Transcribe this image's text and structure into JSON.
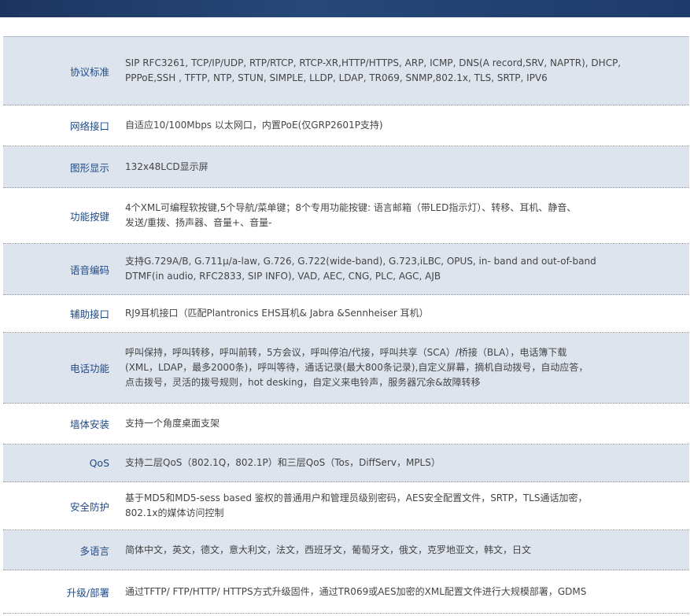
{
  "specs": [
    {
      "label": "协议标准",
      "value": "SIP RFC3261, TCP/IP/UDP, RTP/RTCP, RTCP-XR,HTTP/HTTPS, ARP, ICMP, DNS(A record,SRV, NAPTR), DHCP,\nPPPoE,SSH , TFTP, NTP, STUN, SIMPLE, LLDP, LDAP, TR069, SNMP,802.1x, TLS, SRTP, IPV6"
    },
    {
      "label": "网络接口",
      "value": "自适应10/100Mbps 以太网口，内置PoE(仅GRP2601P支持)"
    },
    {
      "label": "图形显示",
      "value": "132x48LCD显示屏"
    },
    {
      "label": "功能按键",
      "value": "4个XML可编程软按键,5个导航/菜单键；8个专用功能按键: 语言邮箱（带LED指示灯）、转移、耳机、静音、\n发送/重拨、扬声器、音量+、音量-"
    },
    {
      "label": "语音编码",
      "value": "支持G.729A/B, G.711µ/a-law, G.726, G.722(wide-band), G.723,iLBC, OPUS, in- band and out-of-band\nDTMF(in audio, RFC2833, SIP INFO), VAD, AEC, CNG, PLC, AGC, AJB"
    },
    {
      "label": "辅助接口",
      "value": "RJ9耳机接口（匹配Plantronics EHS耳机& Jabra &Sennheiser 耳机）"
    },
    {
      "label": "电话功能",
      "value": "呼叫保持，呼叫转移，呼叫前转，5方会议，呼叫停泊/代接，呼叫共享（SCA）/桥接（BLA），电话簿下载\n(XML，LDAP，最多2000条)，呼叫等待，通话记录(最大800条记录),自定义屏幕，摘机自动拨号，自动应答，\n点击拨号，灵活的拨号规则，hot desking，自定义来电铃声，服务器冗余&故障转移"
    },
    {
      "label": "墙体安装",
      "value": "支持一个角度桌面支架"
    },
    {
      "label": "QoS",
      "value": "支持二层QoS（802.1Q，802.1P）和三层QoS（Tos，DiffServ，MPLS）"
    },
    {
      "label": "安全防护",
      "value": "基于MD5和MD5-sess based 鉴权的普通用户和管理员级别密码，AES安全配置文件，SRTP，TLS通话加密，\n802.1x的媒体访问控制"
    },
    {
      "label": "多语言",
      "value": "简体中文，英文，德文，意大利文，法文，西班牙文，葡萄牙文，俄文，克罗地亚文，韩文，日文"
    },
    {
      "label": "升级/部署",
      "value": "通过TFTP/ FTP/HTTP/ HTTPS方式升级固件，通过TR069或AES加密的XML配置文件进行大规模部署，GDMS"
    }
  ]
}
